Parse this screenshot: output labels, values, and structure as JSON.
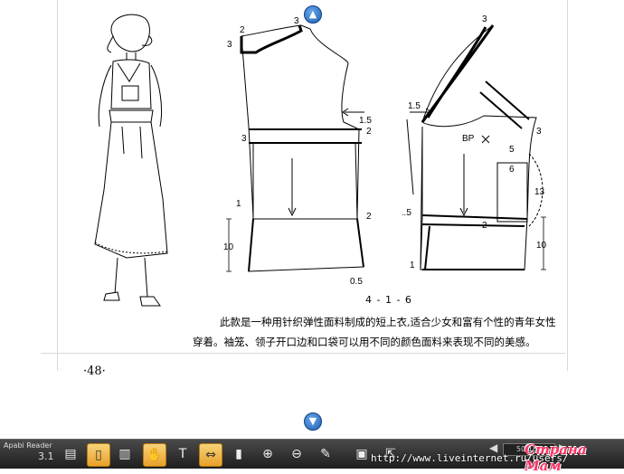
{
  "app": {
    "name": "Apabi Reader",
    "version": "3.1"
  },
  "page": {
    "number": "·48·",
    "figure_label": "4 - 1 - 6",
    "caption_line1": "此款是一种用针织弹性面料制成的短上衣,适合少女和富有个性的青年女性",
    "caption_line2": "穿着。袖笼、领子开口边和口袋可以用不同的颜色面料来表现不同的美感。"
  },
  "diagram_labels": {
    "back_neck_2": "2",
    "back_neck_3a": "3",
    "back_neck_3b": "3",
    "back_1_5": "1.5",
    "back_3": "3",
    "back_2": "2",
    "back_1": "1",
    "back_2b": "2",
    "back_10": "10",
    "back_0_5": "0.5",
    "front_3_top": "3",
    "front_1_5": "1.5",
    "front_bp": "BP",
    "front_3": "3",
    "front_5": "5",
    "front_6": "6",
    "front_13": "13",
    "front_1_5b": "1.5",
    "front_2": "2",
    "front_10": "10",
    "front_1": "1"
  },
  "navigation": {
    "up_icon": "▲",
    "down_icon": "▼"
  },
  "toolbar": {
    "page_indicator": "50/186",
    "prev_icon": "◀",
    "next_icon": "▶",
    "url": "http://www.liveinternet.ru/users/"
  },
  "watermark": "Страна Мам",
  "colors": {
    "toolbar_active": "#e8a12a",
    "nav_button": "#1d5fb5"
  }
}
